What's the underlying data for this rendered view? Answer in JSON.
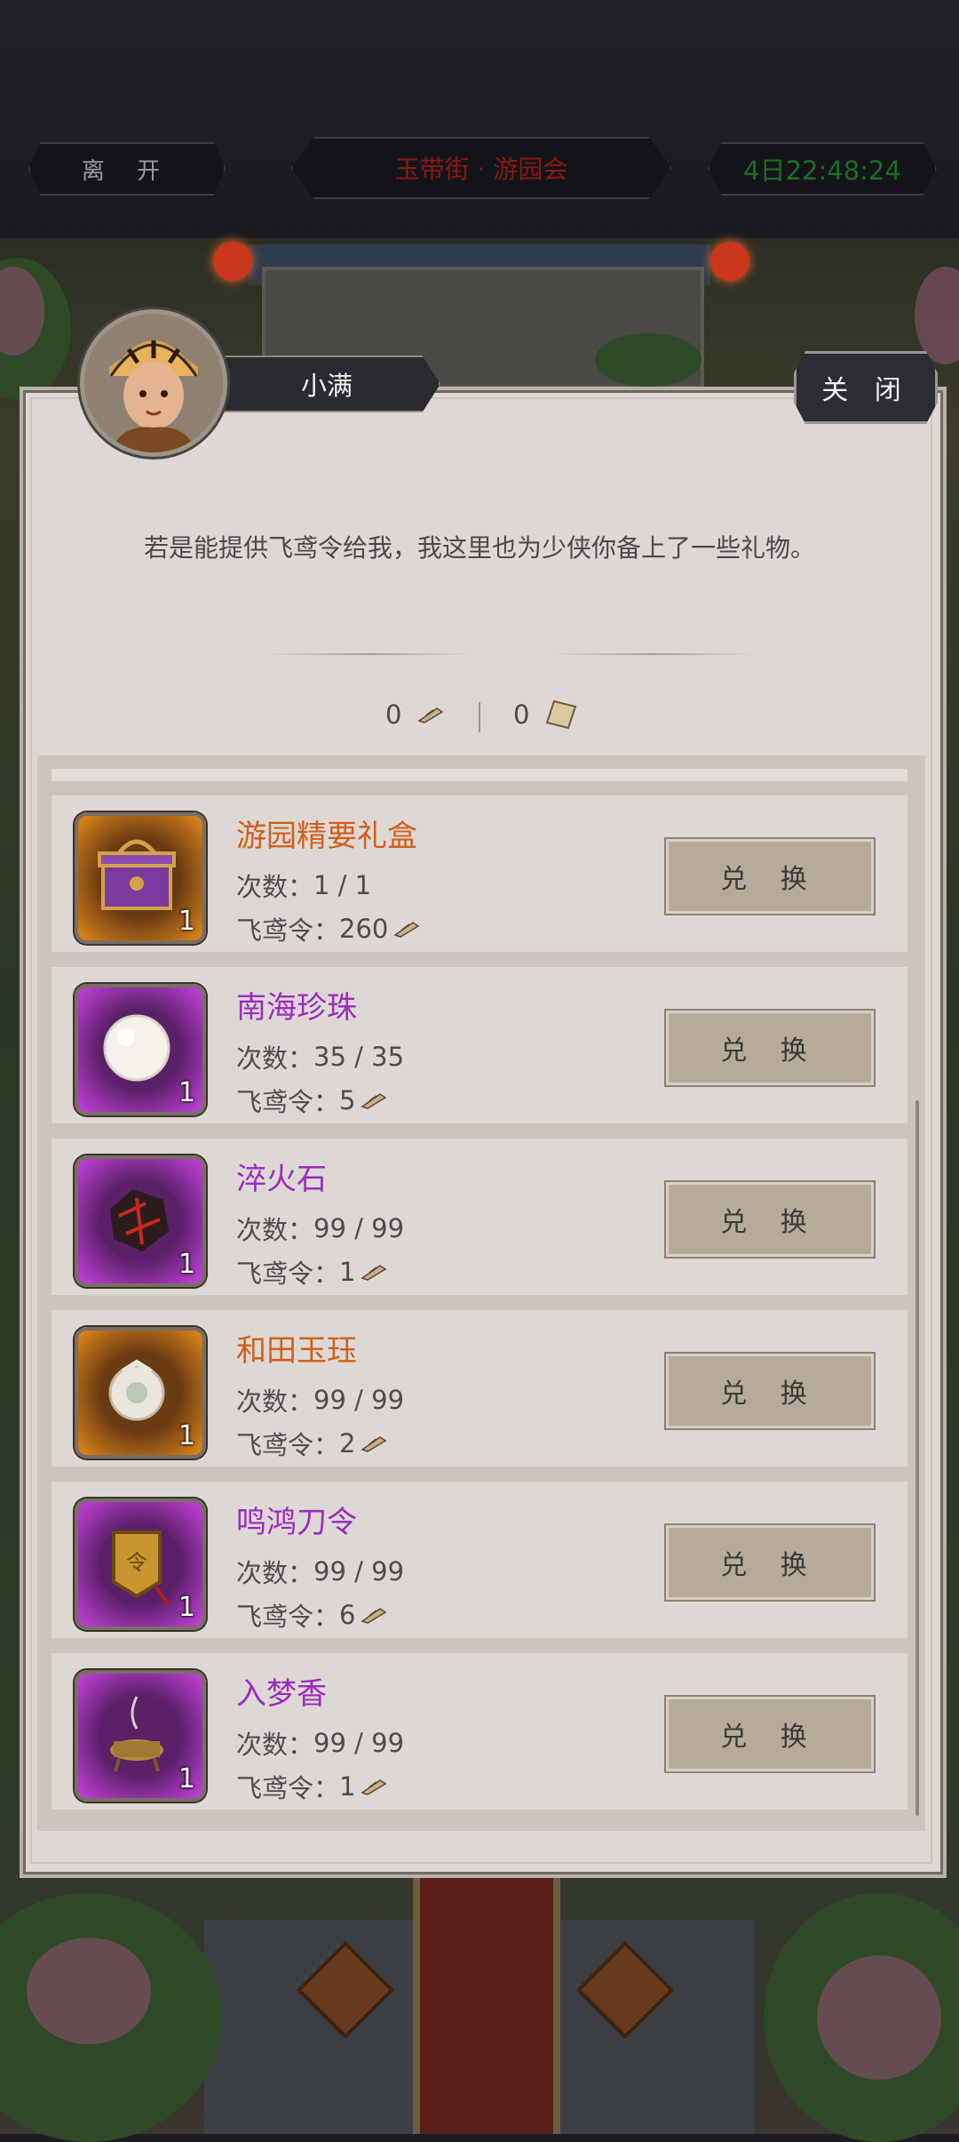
{
  "topbar": {
    "leave_label": "离 开",
    "location_title": "玉带街 · 游园会",
    "countdown": "4日22:48:24"
  },
  "npc": {
    "name": "小满",
    "close_label": "关 闭",
    "dialog": "若是能提供飞鸢令给我，我这里也为少侠你备上了一些礼物。"
  },
  "currency": {
    "feiyuan_count": "0",
    "ticket_count": "0"
  },
  "labels": {
    "count_prefix": "次数：",
    "cost_prefix": "飞鸢令：",
    "exchange": "兑 换"
  },
  "items": [
    {
      "name": "游园精要礼盒",
      "rarity": "orange",
      "qty": "1",
      "count": "1 / 1",
      "cost": "260",
      "icon": "gift-box-icon"
    },
    {
      "name": "南海珍珠",
      "rarity": "purple",
      "qty": "1",
      "count": "35 / 35",
      "cost": "5",
      "icon": "pearl-icon"
    },
    {
      "name": "淬火石",
      "rarity": "purple",
      "qty": "1",
      "count": "99 / 99",
      "cost": "1",
      "icon": "fire-stone-icon"
    },
    {
      "name": "和田玉珏",
      "rarity": "orange",
      "qty": "1",
      "count": "99 / 99",
      "cost": "2",
      "icon": "jade-ring-icon"
    },
    {
      "name": "鸣鸿刀令",
      "rarity": "purple",
      "qty": "1",
      "count": "99 / 99",
      "cost": "6",
      "icon": "blade-token-icon"
    },
    {
      "name": "入梦香",
      "rarity": "purple",
      "qty": "1",
      "count": "99 / 99",
      "cost": "1",
      "icon": "incense-icon"
    }
  ],
  "colors": {
    "orange_rarity": "#d25f1c",
    "purple_rarity": "#9c2bc0",
    "dialog_bg": "#ddd8d4"
  }
}
